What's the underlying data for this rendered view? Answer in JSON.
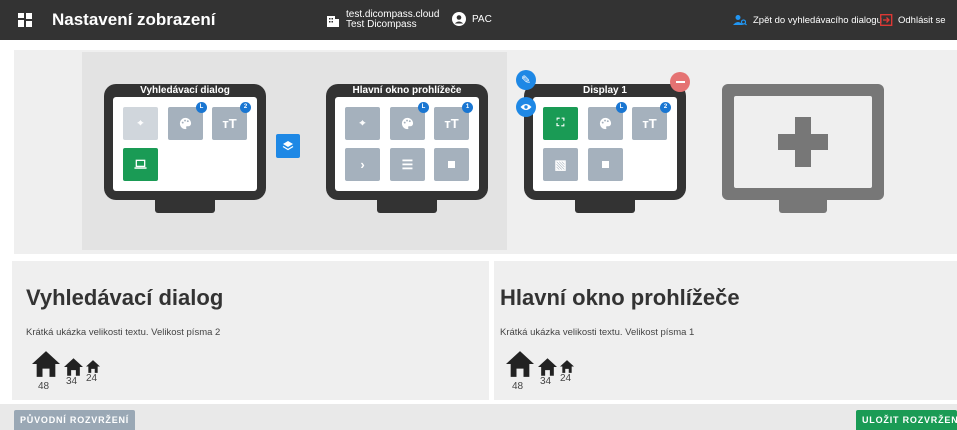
{
  "header": {
    "title": "Nastavení zobrazení",
    "tenant_line1": "test.dicompass.cloud",
    "tenant_line2": "Test Dicompass",
    "user": "PAC",
    "back_link": "Zpět do vyhledávacího dialogu",
    "logout": "Odhlásit se",
    "accent_color": "#2196f3",
    "logout_color": "#e53935"
  },
  "monitors": [
    {
      "title": "Vyhledávací dialog",
      "tiles": [
        {
          "icon": "crosshair-icon",
          "state": "disabled"
        },
        {
          "icon": "palette-icon",
          "badge": "L"
        },
        {
          "icon": "text-size-icon",
          "badge": "2"
        },
        {
          "icon": "laptop-icon",
          "state": "active"
        }
      ]
    },
    {
      "title": "Hlavní okno prohlížeče",
      "tiles": [
        {
          "icon": "crosshair-icon"
        },
        {
          "icon": "palette-icon",
          "badge": "L"
        },
        {
          "icon": "text-size-icon",
          "badge": "1"
        },
        {
          "icon": "chevron-right-icon",
          "glyph": "›"
        },
        {
          "icon": "panel-icon",
          "glyph": "☰"
        },
        {
          "icon": "square-icon"
        }
      ]
    },
    {
      "title": "Display 1",
      "tiles": [
        {
          "icon": "fullscreen-icon",
          "state": "active",
          "glyph": "⛶"
        },
        {
          "icon": "palette-icon",
          "badge": "L"
        },
        {
          "icon": "text-size-icon",
          "badge": "2"
        },
        {
          "icon": "image-off-icon",
          "glyph": "▧"
        },
        {
          "icon": "square-icon"
        }
      ]
    }
  ],
  "cards": [
    {
      "title": "Vyhledávací dialog",
      "sample": "Krátká ukázka velikosti textu. Velikost písma 2",
      "sizes": [
        "48",
        "34",
        "24"
      ]
    },
    {
      "title": "Hlavní okno prohlížeče",
      "sample": "Krátká ukázka velikosti textu. Velikost písma 1",
      "sizes": [
        "48",
        "34",
        "24"
      ]
    }
  ],
  "buttons": {
    "reset": "PŮVODNÍ ROZVRŽENÍ",
    "save": "ULOŽIT ROZVRŽENÍ",
    "reset_color": "#9aa8b5",
    "save_color": "#1a9b55"
  },
  "colors": {
    "tile_gray": "#a5b1bd",
    "tile_green": "#1a9b55",
    "badge_blue": "#1976d2",
    "fab_blue": "#1e88e5",
    "fab_red": "#e57373",
    "frame_dark": "#333333"
  }
}
